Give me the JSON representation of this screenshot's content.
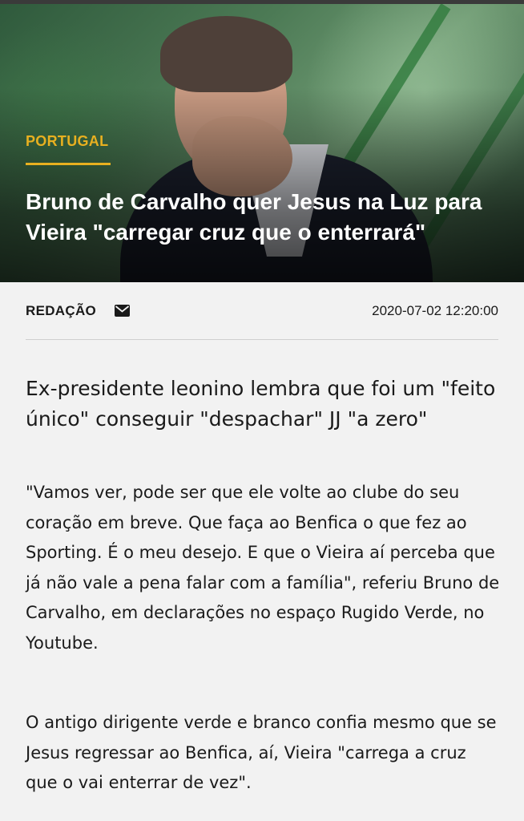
{
  "article": {
    "category": "PORTUGAL",
    "headline": "Bruno de Carvalho quer Jesus na Luz para Vieira \"carregar cruz que o enterrará\"",
    "author": "REDAÇÃO",
    "date": "2020-07-02 12:20:00",
    "subtitle": "Ex-presidente leonino lembra que foi um \"feito único\" conseguir \"despachar\" JJ \"a zero\"",
    "paragraphs": [
      "\"Vamos ver, pode ser que ele volte ao clube do seu coração em breve. Que faça ao Benfica o que fez ao Sporting. É o meu desejo. E que o Vieira aí perceba que já não vale a pena falar com a família\", referiu Bruno de Carvalho, em declarações no espaço Rugido Verde, no Youtube.",
      "O antigo dirigente verde e branco confia mesmo que se Jesus regressar ao Benfica, aí, Vieira \"carrega a cruz que o vai enterrar de vez\"."
    ]
  },
  "icons": {
    "author_contact": "envelope-icon"
  },
  "colors": {
    "accent": "#e8b020",
    "text": "#1a1a1a",
    "background": "#f2f2f2"
  }
}
